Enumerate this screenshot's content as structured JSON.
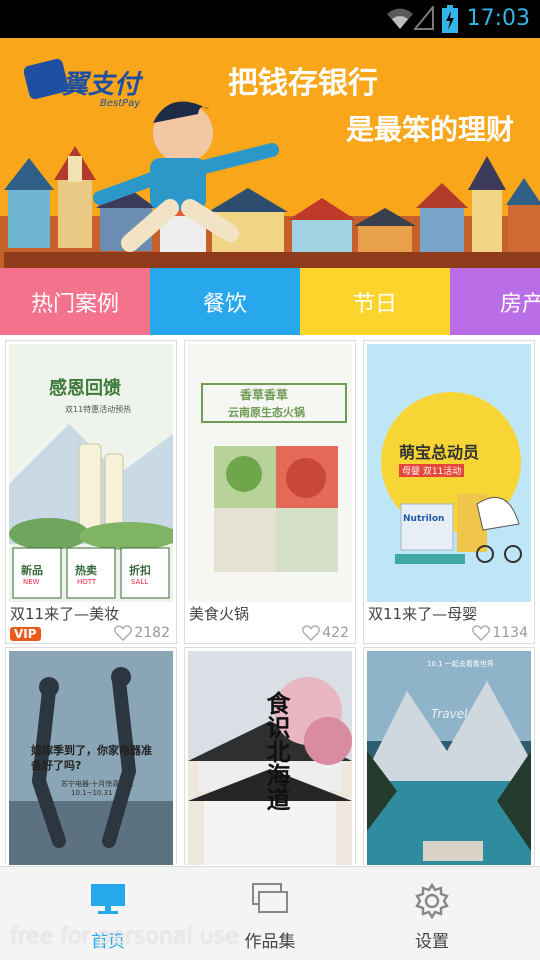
{
  "status_bar": {
    "time": "17:03"
  },
  "banner": {
    "brand": "翼支付",
    "brand_en": "BestPay",
    "slogan_line1": "把钱存银行",
    "slogan_line2": "是最笨的理财"
  },
  "categories": [
    "热门案例",
    "餐饮",
    "节日",
    "房产"
  ],
  "cards": [
    {
      "title": "双11来了—美妆",
      "likes": "2182",
      "badge": "VIP",
      "pic_text": {
        "headline": "感恩回馈",
        "sub": "双11特惠活动预热",
        "items": [
          "新品",
          "热卖",
          "折扣"
        ],
        "items_en": [
          "NEW",
          "HOTT",
          "SALL"
        ]
      }
    },
    {
      "title": "美食火锅",
      "likes": "422",
      "pic_text": {
        "headline": "香草香草",
        "sub": "云南原生态火锅"
      }
    },
    {
      "title": "双11来了—母婴",
      "likes": "1134",
      "pic_text": {
        "headline": "萌宝总动员",
        "sub": "母婴 双11活动",
        "brand": "Nutrilon"
      }
    },
    {
      "title": "",
      "likes": "",
      "pic_text": {
        "headline": "婚嫁季到了，你家电器准备好了吗?",
        "sub": "苏宁电器·十月惊喜放送",
        "date": "10.1~10.31"
      }
    },
    {
      "title": "",
      "likes": "",
      "pic_text": {
        "headline": "食识北海道"
      }
    },
    {
      "title": "",
      "likes": "",
      "pic_text": {
        "headline": "10.1 一起去看看世界",
        "sub": "Travel"
      }
    }
  ],
  "tabbar": {
    "home": "首页",
    "works": "作品集",
    "settings": "设置"
  },
  "watermark": "free for personal use",
  "colors": {
    "accent": "#28a8ec",
    "banner": "#f9a61a",
    "vip": "#ea5a1a"
  }
}
